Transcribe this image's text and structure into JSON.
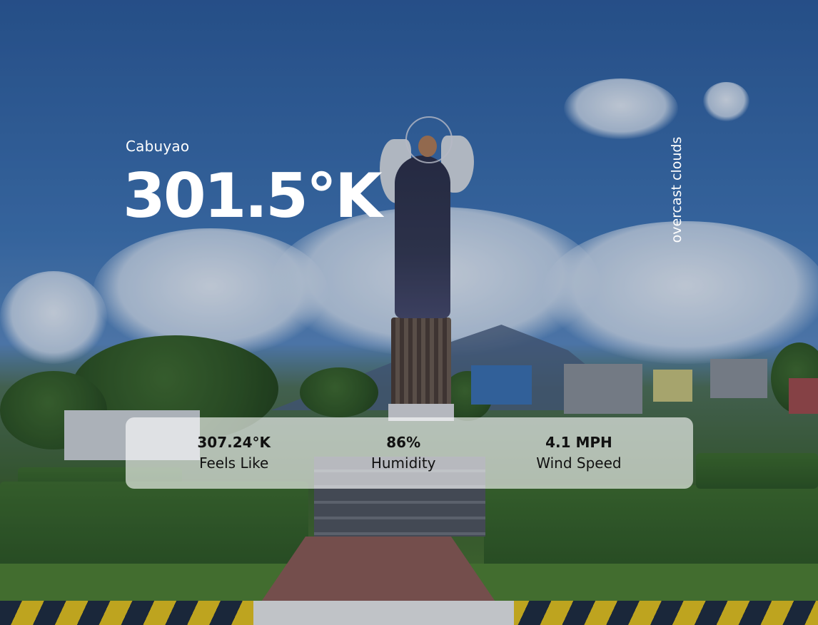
{
  "location": {
    "city": "Cabuyao"
  },
  "current": {
    "temperature": "301.5°K",
    "condition": "overcast clouds"
  },
  "details": {
    "feels_like": {
      "value": "307.24°K",
      "label": "Feels Like"
    },
    "humidity": {
      "value": "86%",
      "label": "Humidity"
    },
    "wind_speed": {
      "value": "4.1 MPH",
      "label": "Wind Speed"
    }
  },
  "background": {
    "image_subject": "angel-statue-landmark",
    "sky_color": "#3f74b4",
    "panel_color": "#ffffff"
  }
}
